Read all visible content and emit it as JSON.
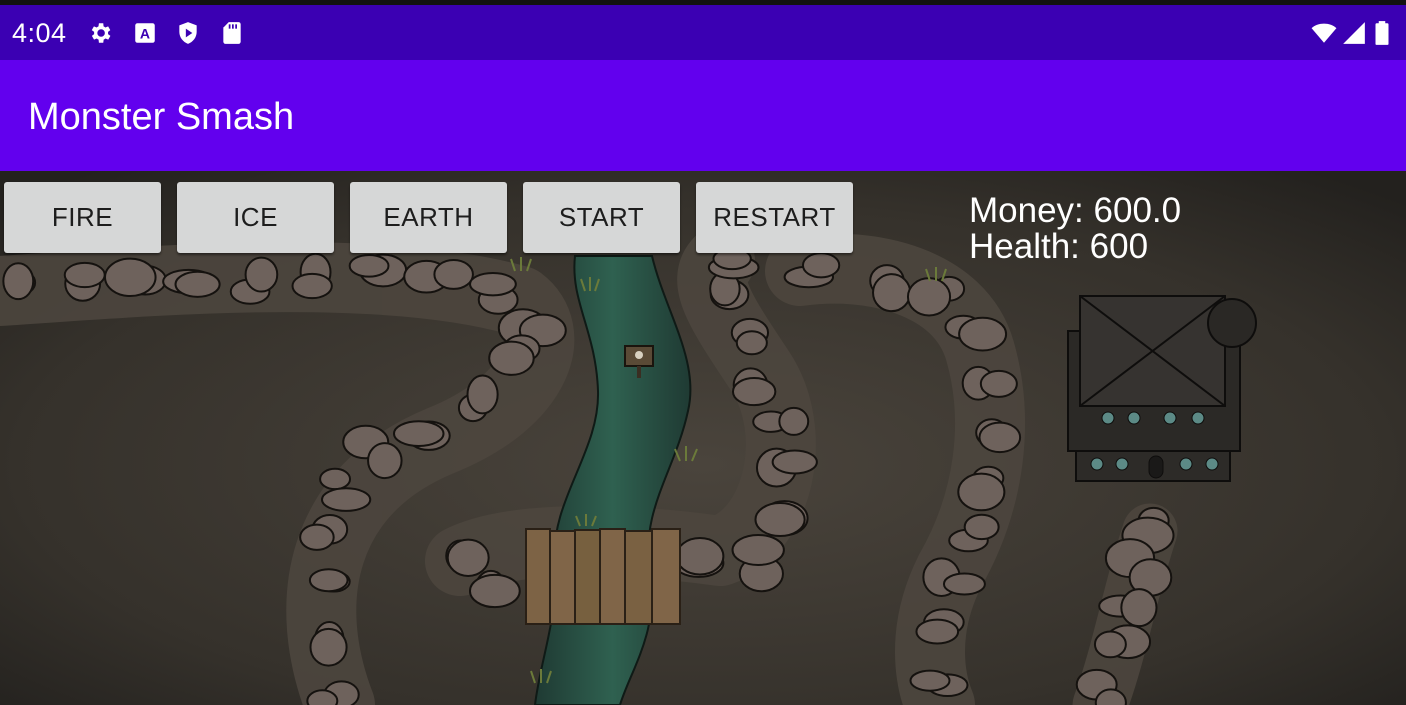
{
  "status_bar": {
    "time": "4:04",
    "left_icons": [
      "settings-icon",
      "keyboard-a-icon",
      "shield-play-icon",
      "sd-card-icon"
    ],
    "right_icons": [
      "wifi-icon",
      "cell-signal-icon",
      "battery-icon"
    ]
  },
  "app_bar": {
    "title": "Monster Smash",
    "color": "#6200ee"
  },
  "toolbar": {
    "fire_label": "FIRE",
    "ice_label": "ICE",
    "earth_label": "EARTH",
    "start_label": "START",
    "restart_label": "RESTART"
  },
  "hud": {
    "money_label": "Money:",
    "money_value": "600.0",
    "health_label": "Health:",
    "health_value": "600"
  },
  "colors": {
    "status_bar": "#3b00b3",
    "button_bg": "#d6d7d7",
    "ground": "#3a3530",
    "stone": "#6e625c",
    "river": "#2f5a4a",
    "bridge": "#7a6040"
  }
}
